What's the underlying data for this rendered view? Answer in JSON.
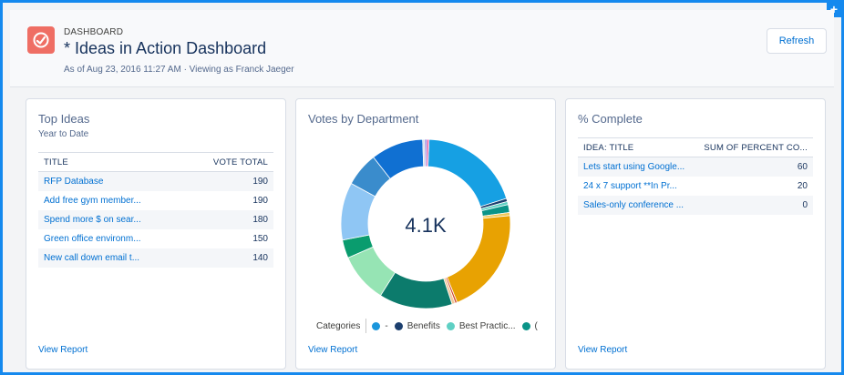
{
  "header": {
    "eyebrow": "DASHBOARD",
    "title": "* Ideas in Action Dashboard",
    "subline": "As of Aug 23, 2016 11:27 AM · Viewing as Franck Jaeger",
    "refresh_label": "Refresh",
    "icon": "dashboard-gauge-icon",
    "add_icon": "plus-icon"
  },
  "cards": {
    "top_ideas": {
      "title": "Top Ideas",
      "subtitle": "Year to Date",
      "columns": [
        "TITLE",
        "VOTE TOTAL"
      ],
      "rows": [
        {
          "title": "RFP Database",
          "votes": "190"
        },
        {
          "title": "Add free gym member...",
          "votes": "190"
        },
        {
          "title": "Spend more $ on sear...",
          "votes": "180"
        },
        {
          "title": "Green office environm...",
          "votes": "150"
        },
        {
          "title": "New call down email t...",
          "votes": "140"
        }
      ],
      "view_report": "View Report"
    },
    "votes_by_department": {
      "title": "Votes by Department",
      "total": "4.1K",
      "legend_label": "Categories",
      "legend_items": [
        {
          "label": "-",
          "color": "#1b96dc"
        },
        {
          "label": "Benefits",
          "color": "#1c3f6e"
        },
        {
          "label": "Best Practic...",
          "color": "#5fd0c4"
        },
        {
          "label": "(",
          "color": "#0a9488"
        }
      ],
      "view_report": "View Report"
    },
    "percent_complete": {
      "title": "% Complete",
      "columns": [
        "IDEA: TITLE",
        "SUM OF PERCENT CO..."
      ],
      "rows": [
        {
          "title": "Lets start using Google...",
          "value": "60"
        },
        {
          "title": "24 x 7 support **In Pr...",
          "value": "20"
        },
        {
          "title": "Sales-only conference ...",
          "value": "0"
        }
      ],
      "view_report": "View Report"
    }
  },
  "chart_data": {
    "type": "pie",
    "title": "Votes by Department",
    "center_label": "4.1K",
    "legend_title": "Categories",
    "slices": [
      {
        "label": "-",
        "value": 19.5,
        "color": "#16a0e3"
      },
      {
        "label": "Benefits",
        "value": 0.6,
        "color": "#1c3f6e"
      },
      {
        "label": "Best Practic...",
        "value": 0.6,
        "color": "#5fd0c4"
      },
      {
        "label": "(",
        "value": 1.5,
        "color": "#0a9488"
      },
      {
        "label": "",
        "value": 0.6,
        "color": "#f0c85a"
      },
      {
        "label": "",
        "value": 20.5,
        "color": "#e8a202"
      },
      {
        "label": "",
        "value": 0.4,
        "color": "#d1492e"
      },
      {
        "label": "",
        "value": 0.6,
        "color": "#f2c89b"
      },
      {
        "label": "",
        "value": 14,
        "color": "#0c7b6c"
      },
      {
        "label": "",
        "value": 9.5,
        "color": "#96e4b4"
      },
      {
        "label": "",
        "value": 3.5,
        "color": "#0a9c6e"
      },
      {
        "label": "",
        "value": 11,
        "color": "#8fc6f4"
      },
      {
        "label": "",
        "value": 6.5,
        "color": "#3a8ccc"
      },
      {
        "label": "",
        "value": 10,
        "color": "#1070d2"
      },
      {
        "label": "",
        "value": 0.4,
        "color": "#cfd9e6"
      },
      {
        "label": "",
        "value": 0.4,
        "color": "#8a80e0"
      },
      {
        "label": "",
        "value": 0.4,
        "color": "#e44a9c"
      }
    ]
  }
}
